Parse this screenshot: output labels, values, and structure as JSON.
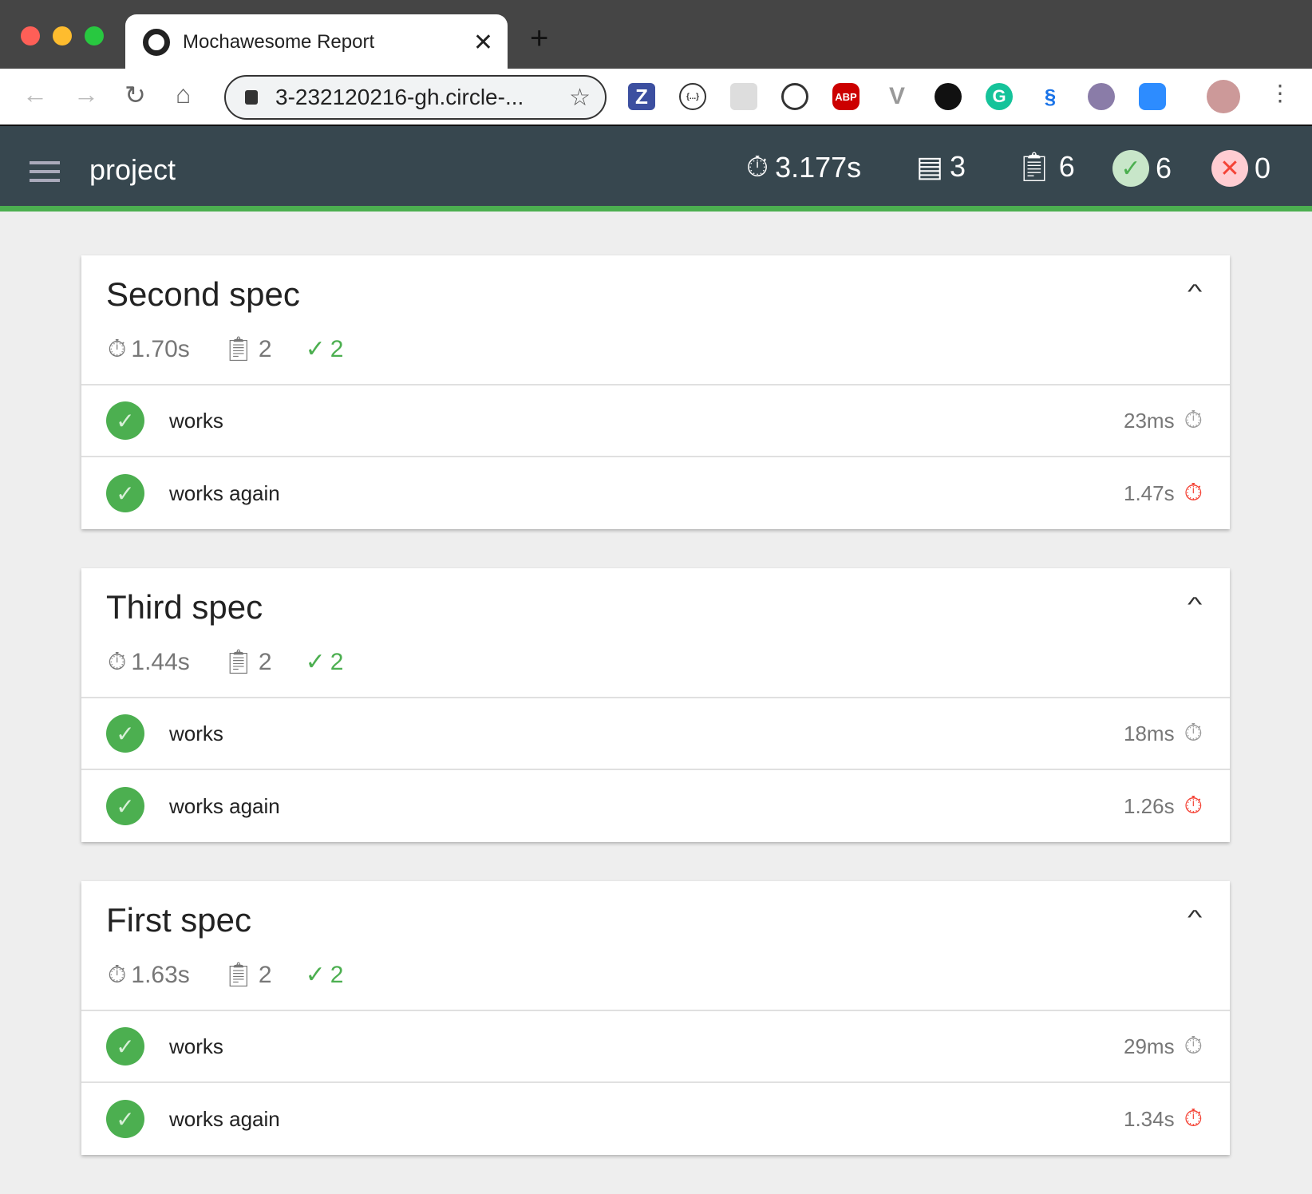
{
  "browser": {
    "tab_title": "Mochawesome Report",
    "url": "3-232120216-gh.circle-...",
    "extensions": [
      "Z",
      "{...}",
      "",
      "",
      "ABP",
      "V",
      "",
      "G",
      "",
      "",
      "",
      ""
    ]
  },
  "header": {
    "title": "project",
    "duration": "3.177s",
    "suites": "3",
    "tests": "6",
    "passes": "6",
    "failures": "0",
    "colors": {
      "bg": "#37474f",
      "accent": "#4caf50",
      "fail": "#f44336"
    }
  },
  "suites": [
    {
      "title": "Second spec",
      "duration": "1.70s",
      "tests": "2",
      "passes": "2",
      "items": [
        {
          "name": "works",
          "duration": "23ms",
          "slow": false
        },
        {
          "name": "works again",
          "duration": "1.47s",
          "slow": true
        }
      ]
    },
    {
      "title": "Third spec",
      "duration": "1.44s",
      "tests": "2",
      "passes": "2",
      "items": [
        {
          "name": "works",
          "duration": "18ms",
          "slow": false
        },
        {
          "name": "works again",
          "duration": "1.26s",
          "slow": true
        }
      ]
    },
    {
      "title": "First spec",
      "duration": "1.63s",
      "tests": "2",
      "passes": "2",
      "items": [
        {
          "name": "works",
          "duration": "29ms",
          "slow": false
        },
        {
          "name": "works again",
          "duration": "1.34s",
          "slow": true
        }
      ]
    }
  ]
}
